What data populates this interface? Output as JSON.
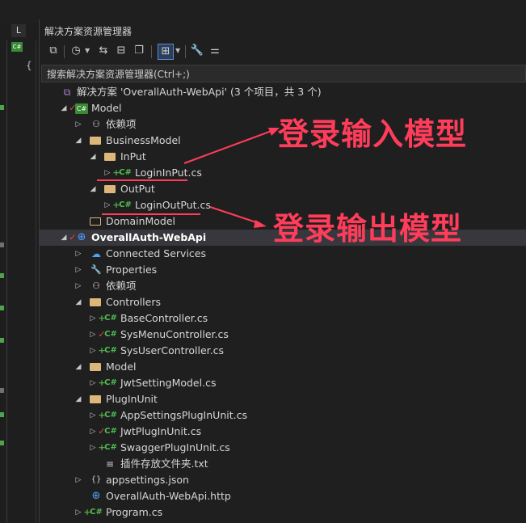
{
  "panel": {
    "title": "解决方案资源管理器",
    "search_placeholder": "搜索解决方案资源管理器(Ctrl+;)"
  },
  "left_strip": {
    "tab_label": "L",
    "brace": "{"
  },
  "toolbar_icons": [
    "vs-switch-view-icon",
    "history-icon",
    "sync-icon",
    "collapse-icon",
    "show-all-files-icon",
    "filter-pending-icon",
    "properties-wrench-icon",
    "preview-icon"
  ],
  "tree": [
    {
      "label": "解决方案 'OverallAuth-WebApi' (3 个项目，共 3 个)",
      "icon": "solution-icon",
      "mod": "",
      "expander": "",
      "indent": 0
    },
    {
      "label": "Model",
      "icon": "csproj-icon",
      "mod": "check",
      "expander": "open",
      "indent": 1
    },
    {
      "label": "依赖项",
      "icon": "dependencies-icon",
      "mod": "",
      "expander": "closed",
      "indent": 2
    },
    {
      "label": "BusinessModel",
      "icon": "folder-open-icon",
      "mod": "",
      "expander": "open",
      "indent": 2
    },
    {
      "label": "InPut",
      "icon": "folder-open-icon",
      "mod": "",
      "expander": "open",
      "indent": 3
    },
    {
      "label": "LoginInPut.cs",
      "icon": "cs-file-icon",
      "mod": "add",
      "expander": "closed",
      "indent": 4
    },
    {
      "label": "OutPut",
      "icon": "folder-open-icon",
      "mod": "",
      "expander": "open",
      "indent": 3
    },
    {
      "label": "LoginOutPut.cs",
      "icon": "cs-file-icon",
      "mod": "add",
      "expander": "closed",
      "indent": 4
    },
    {
      "label": "DomainModel",
      "icon": "folder-icon",
      "mod": "",
      "expander": "",
      "indent": 2
    },
    {
      "label": "OverallAuth-WebApi",
      "icon": "web-project-icon",
      "mod": "check",
      "expander": "open",
      "indent": 1
    },
    {
      "label": "Connected Services",
      "icon": "connected-services-icon",
      "mod": "",
      "expander": "closed",
      "indent": 2
    },
    {
      "label": "Properties",
      "icon": "properties-icon",
      "mod": "",
      "expander": "closed",
      "indent": 2
    },
    {
      "label": "依赖项",
      "icon": "dependencies-icon",
      "mod": "",
      "expander": "closed",
      "indent": 2
    },
    {
      "label": "Controllers",
      "icon": "folder-open-icon",
      "mod": "",
      "expander": "open",
      "indent": 2
    },
    {
      "label": "BaseController.cs",
      "icon": "cs-file-icon",
      "mod": "add",
      "expander": "closed",
      "indent": 3
    },
    {
      "label": "SysMenuController.cs",
      "icon": "cs-file-icon",
      "mod": "check",
      "expander": "closed",
      "indent": 3
    },
    {
      "label": "SysUserController.cs",
      "icon": "cs-file-icon",
      "mod": "add",
      "expander": "closed",
      "indent": 3
    },
    {
      "label": "Model",
      "icon": "folder-open-icon",
      "mod": "",
      "expander": "open",
      "indent": 2
    },
    {
      "label": "JwtSettingModel.cs",
      "icon": "cs-file-icon",
      "mod": "add",
      "expander": "closed",
      "indent": 3
    },
    {
      "label": "PlugInUnit",
      "icon": "folder-open-icon",
      "mod": "",
      "expander": "open",
      "indent": 2
    },
    {
      "label": "AppSettingsPlugInUnit.cs",
      "icon": "cs-file-icon",
      "mod": "add",
      "expander": "closed",
      "indent": 3
    },
    {
      "label": "JwtPlugInUnit.cs",
      "icon": "cs-file-icon",
      "mod": "check",
      "expander": "closed",
      "indent": 3
    },
    {
      "label": "SwaggerPlugInUnit.cs",
      "icon": "cs-file-icon",
      "mod": "add",
      "expander": "closed",
      "indent": 3
    },
    {
      "label": "插件存放文件夹.txt",
      "icon": "text-file-icon",
      "mod": "",
      "expander": "",
      "indent": 3
    },
    {
      "label": "appsettings.json",
      "icon": "json-file-icon",
      "mod": "",
      "expander": "closed",
      "indent": 2
    },
    {
      "label": "OverallAuth-WebApi.http",
      "icon": "http-file-icon",
      "mod": "",
      "expander": "",
      "indent": 2
    },
    {
      "label": "Program.cs",
      "icon": "cs-file-icon",
      "mod": "add",
      "expander": "closed",
      "indent": 2
    }
  ],
  "annotations": {
    "input_model": "登录输入模型",
    "output_model": "登录输出模型"
  },
  "colors": {
    "accent": "#7160e8",
    "annotation": "#ff3d5a",
    "added": "#57a64a",
    "modified": "#e5484d",
    "folder": "#dcb67a"
  }
}
